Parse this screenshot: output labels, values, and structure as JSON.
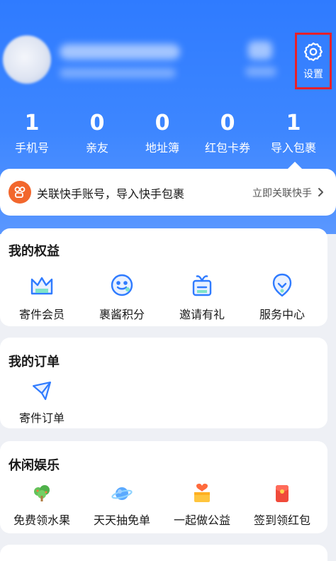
{
  "profile": {
    "settings_label": "设置"
  },
  "stats": [
    {
      "value": "1",
      "label": "手机号"
    },
    {
      "value": "0",
      "label": "亲友"
    },
    {
      "value": "0",
      "label": "地址簿"
    },
    {
      "value": "0",
      "label": "红包卡券"
    },
    {
      "value": "1",
      "label": "导入包裹"
    }
  ],
  "link_banner": {
    "text": "关联快手账号，导入快手包裹",
    "action": "立即关联快手"
  },
  "benefits": {
    "title": "我的权益",
    "items": [
      {
        "label": "寄件会员",
        "icon": "crown-icon"
      },
      {
        "label": "裹酱积分",
        "icon": "smiley-icon"
      },
      {
        "label": "邀请有礼",
        "icon": "gift-icon"
      },
      {
        "label": "服务中心",
        "icon": "service-badge-icon"
      }
    ]
  },
  "orders": {
    "title": "我的订单",
    "items": [
      {
        "label": "寄件订单",
        "icon": "paper-plane-icon"
      }
    ]
  },
  "leisure": {
    "title": "休闲娱乐",
    "items": [
      {
        "label": "免费领水果",
        "icon": "tree-icon"
      },
      {
        "label": "天天抽免单",
        "icon": "planet-icon"
      },
      {
        "label": "一起做公益",
        "icon": "heart-box-icon"
      },
      {
        "label": "签到领红包",
        "icon": "red-envelope-icon"
      }
    ]
  },
  "colors": {
    "brand_blue": "#2f7bff",
    "highlight_red": "#e8202a",
    "link_orange": "#f2672d"
  }
}
